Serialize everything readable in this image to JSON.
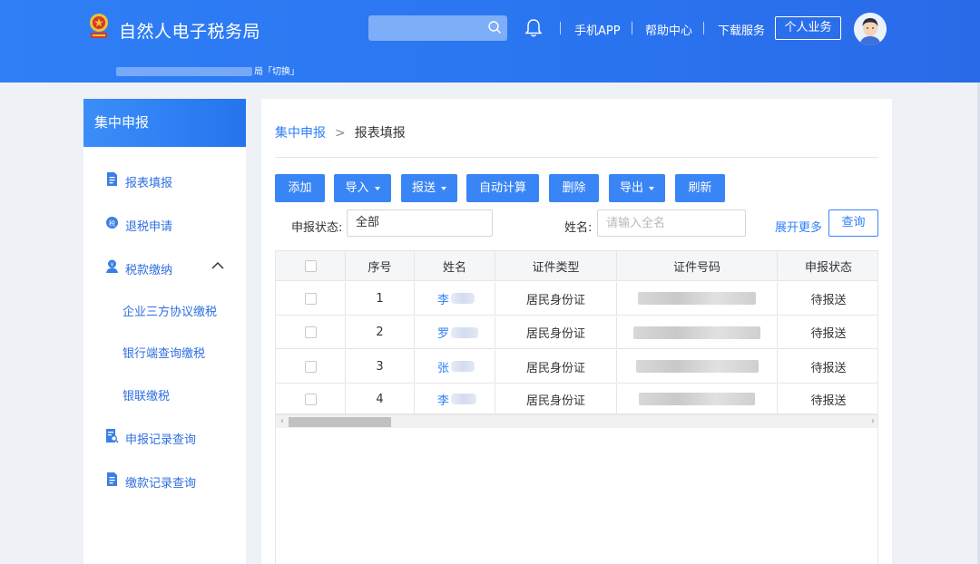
{
  "header": {
    "site_title": "自然人电子税务局",
    "tax_bureau_suffix": "局「切换」",
    "search": {
      "placeholder": ""
    },
    "nav": {
      "app": "手机APP",
      "help": "帮助中心",
      "download": "下载服务"
    },
    "personal_button": "个人业务"
  },
  "sidebar": {
    "title": "集中申报",
    "items": [
      {
        "label": "报表填报",
        "icon": "document-icon"
      },
      {
        "label": "退税申请",
        "icon": "refund-icon"
      },
      {
        "label": "税款缴纳",
        "icon": "payment-icon",
        "expanded": true
      },
      {
        "label": "申报记录查询",
        "icon": "record-search-icon"
      },
      {
        "label": "缴款记录查询",
        "icon": "document-icon"
      }
    ],
    "sub_items": [
      "企业三方协议缴税",
      "银行端查询缴税",
      "银联缴税"
    ]
  },
  "breadcrumb": {
    "parent": "集中申报",
    "separator": ">",
    "current": "报表填报"
  },
  "toolbar": {
    "add": "添加",
    "import": "导入",
    "submit": "报送",
    "auto_calc": "自动计算",
    "delete": "删除",
    "export": "导出",
    "refresh": "刷新"
  },
  "filters": {
    "status_label": "申报状态:",
    "status_value": "全部",
    "name_label": "姓名:",
    "name_placeholder": "请输入全名",
    "expand_more": "展开更多",
    "query": "查询"
  },
  "table": {
    "columns": [
      "序号",
      "姓名",
      "证件类型",
      "证件号码",
      "申报状态"
    ],
    "rows": [
      {
        "index": "1",
        "name": "李",
        "id_type": "居民身份证",
        "status": "待报送"
      },
      {
        "index": "2",
        "name": "罗",
        "id_type": "居民身份证",
        "status": "待报送"
      },
      {
        "index": "3",
        "name": "张",
        "id_type": "居民身份证",
        "status": "待报送"
      },
      {
        "index": "4",
        "name": "李",
        "id_type": "居民身份证",
        "status": "待报送"
      }
    ]
  },
  "colors": {
    "brand_blue": "#2f7ff6",
    "button_blue": "#3a85f5"
  }
}
